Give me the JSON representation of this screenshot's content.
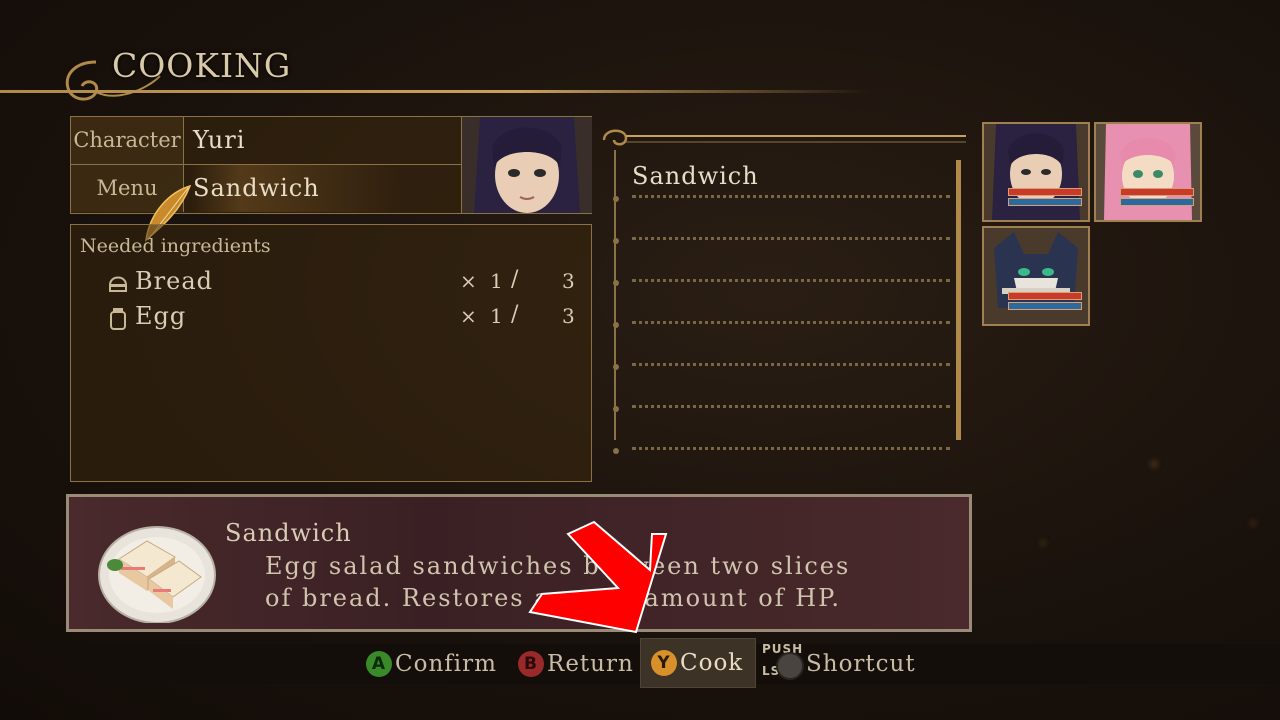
{
  "header": {
    "title": "COOKING"
  },
  "info": {
    "character_label": "Character",
    "character_value": "Yuri",
    "menu_label": "Menu",
    "menu_value": "Sandwich"
  },
  "ingredients": {
    "heading": "Needed ingredients",
    "items": [
      {
        "name": "Bread",
        "x": "×",
        "have": "1",
        "slash": "/",
        "need": "3",
        "icon": "bread-icon"
      },
      {
        "name": "Egg",
        "x": "×",
        "have": "1",
        "slash": "/",
        "need": "3",
        "icon": "egg-icon"
      }
    ]
  },
  "recipe_list": {
    "items": [
      "Sandwich",
      "",
      "",
      "",
      "",
      "",
      ""
    ]
  },
  "party": [
    "Yuri",
    "Estelle",
    "Repede"
  ],
  "description": {
    "title": "Sandwich",
    "line1": "Egg salad sandwiches between two slices",
    "line2": "of bread. Restores a small amount of HP."
  },
  "controls": {
    "confirm_key": "A",
    "confirm": "Confirm",
    "return_key": "B",
    "return": "Return",
    "cook_key": "Y",
    "cook": "Cook",
    "push": "PUSH",
    "ls": "LS",
    "shortcut": "Shortcut"
  },
  "colors": {
    "accent_gold": "#b08a4a",
    "btn_a": "#3a8a2a",
    "btn_b": "#9a2a2a",
    "btn_y": "#d8902a",
    "arrow_red": "#ff0000"
  }
}
